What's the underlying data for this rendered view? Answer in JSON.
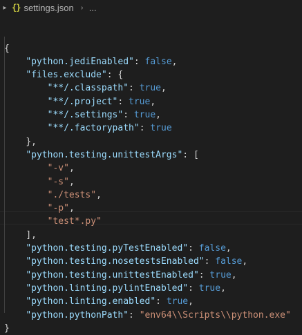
{
  "breadcrumb": {
    "file_icon": "{}",
    "file_name": "settings.json",
    "ellipsis": "..."
  },
  "editor": {
    "lines": [
      {
        "indent": "",
        "tokens": [
          {
            "t": "p",
            "v": "{"
          }
        ]
      },
      {
        "indent": "    ",
        "tokens": [
          {
            "t": "k",
            "v": "\"python.jediEnabled\""
          },
          {
            "t": "p",
            "v": ": "
          },
          {
            "t": "b",
            "v": "false"
          },
          {
            "t": "p",
            "v": ","
          }
        ]
      },
      {
        "indent": "    ",
        "tokens": [
          {
            "t": "k",
            "v": "\"files.exclude\""
          },
          {
            "t": "p",
            "v": ": {"
          }
        ]
      },
      {
        "indent": "        ",
        "tokens": [
          {
            "t": "k",
            "v": "\"**/.classpath\""
          },
          {
            "t": "p",
            "v": ": "
          },
          {
            "t": "b",
            "v": "true"
          },
          {
            "t": "p",
            "v": ","
          }
        ]
      },
      {
        "indent": "        ",
        "tokens": [
          {
            "t": "k",
            "v": "\"**/.project\""
          },
          {
            "t": "p",
            "v": ": "
          },
          {
            "t": "b",
            "v": "true"
          },
          {
            "t": "p",
            "v": ","
          }
        ]
      },
      {
        "indent": "        ",
        "tokens": [
          {
            "t": "k",
            "v": "\"**/.settings\""
          },
          {
            "t": "p",
            "v": ": "
          },
          {
            "t": "b",
            "v": "true"
          },
          {
            "t": "p",
            "v": ","
          }
        ]
      },
      {
        "indent": "        ",
        "tokens": [
          {
            "t": "k",
            "v": "\"**/.factorypath\""
          },
          {
            "t": "p",
            "v": ": "
          },
          {
            "t": "b",
            "v": "true"
          }
        ]
      },
      {
        "indent": "    ",
        "tokens": [
          {
            "t": "p",
            "v": "},"
          }
        ]
      },
      {
        "indent": "    ",
        "tokens": [
          {
            "t": "k",
            "v": "\"python.testing.unittestArgs\""
          },
          {
            "t": "p",
            "v": ": ["
          }
        ]
      },
      {
        "indent": "        ",
        "tokens": [
          {
            "t": "s",
            "v": "\"-v\""
          },
          {
            "t": "p",
            "v": ","
          }
        ]
      },
      {
        "indent": "        ",
        "tokens": [
          {
            "t": "s",
            "v": "\"-s\""
          },
          {
            "t": "p",
            "v": ","
          }
        ]
      },
      {
        "indent": "        ",
        "tokens": [
          {
            "t": "s",
            "v": "\"./tests\""
          },
          {
            "t": "p",
            "v": ","
          }
        ]
      },
      {
        "indent": "        ",
        "tokens": [
          {
            "t": "s",
            "v": "\"-p\""
          },
          {
            "t": "p",
            "v": ","
          }
        ]
      },
      {
        "indent": "        ",
        "tokens": [
          {
            "t": "s",
            "v": "\"test*.py\""
          }
        ]
      },
      {
        "indent": "    ",
        "tokens": [
          {
            "t": "p",
            "v": "],"
          }
        ]
      },
      {
        "indent": "    ",
        "tokens": [
          {
            "t": "k",
            "v": "\"python.testing.pyTestEnabled\""
          },
          {
            "t": "p",
            "v": ": "
          },
          {
            "t": "b",
            "v": "false"
          },
          {
            "t": "p",
            "v": ","
          }
        ]
      },
      {
        "indent": "    ",
        "tokens": [
          {
            "t": "k",
            "v": "\"python.testing.nosetestsEnabled\""
          },
          {
            "t": "p",
            "v": ": "
          },
          {
            "t": "b",
            "v": "false"
          },
          {
            "t": "p",
            "v": ","
          }
        ]
      },
      {
        "indent": "    ",
        "tokens": [
          {
            "t": "k",
            "v": "\"python.testing.unittestEnabled\""
          },
          {
            "t": "p",
            "v": ": "
          },
          {
            "t": "b",
            "v": "true"
          },
          {
            "t": "p",
            "v": ","
          }
        ]
      },
      {
        "indent": "    ",
        "tokens": [
          {
            "t": "k",
            "v": "\"python.linting.pylintEnabled\""
          },
          {
            "t": "p",
            "v": ": "
          },
          {
            "t": "b",
            "v": "true"
          },
          {
            "t": "p",
            "v": ","
          }
        ]
      },
      {
        "indent": "    ",
        "tokens": [
          {
            "t": "k",
            "v": "\"python.linting.enabled\""
          },
          {
            "t": "p",
            "v": ": "
          },
          {
            "t": "b",
            "v": "true"
          },
          {
            "t": "p",
            "v": ","
          }
        ]
      },
      {
        "indent": "    ",
        "tokens": [
          {
            "t": "k",
            "v": "\"python.pythonPath\""
          },
          {
            "t": "p",
            "v": ": "
          },
          {
            "t": "s",
            "v": "\"env64\\\\Scripts\\\\python.exe\""
          }
        ]
      },
      {
        "indent": "",
        "tokens": [
          {
            "t": "p",
            "v": "}"
          }
        ]
      }
    ]
  },
  "colors": {
    "background": "#1e1e1e",
    "key": "#9cdcfe",
    "string": "#ce9178",
    "boolean": "#569cd6",
    "punctuation": "#d4d4d4",
    "json_icon": "#cbcb41"
  }
}
